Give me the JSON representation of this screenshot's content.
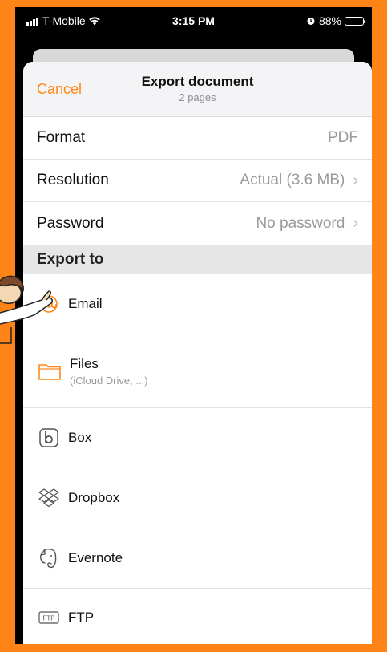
{
  "status": {
    "carrier": "T-Mobile",
    "time": "3:15 PM",
    "battery": "88%",
    "battery_level": 0.88,
    "alarm_icon": "alarm-icon",
    "wifi_icon": "wifi-icon"
  },
  "nav": {
    "cancel": "Cancel",
    "title": "Export document",
    "subtitle": "2 pages"
  },
  "settings": [
    {
      "label": "Format",
      "value": "PDF",
      "chevron": false
    },
    {
      "label": "Resolution",
      "value": "Actual (3.6 MB)",
      "chevron": true
    },
    {
      "label": "Password",
      "value": "No password",
      "chevron": true
    }
  ],
  "export_header": "Export to",
  "export_targets": [
    {
      "label": "Email",
      "sub": "",
      "icon": "email-icon"
    },
    {
      "label": "Files",
      "sub": "(iCloud Drive, ...)",
      "icon": "folder-icon"
    },
    {
      "label": "Box",
      "sub": "",
      "icon": "box-icon"
    },
    {
      "label": "Dropbox",
      "sub": "",
      "icon": "dropbox-icon"
    },
    {
      "label": "Evernote",
      "sub": "",
      "icon": "evernote-icon"
    },
    {
      "label": "FTP",
      "sub": "",
      "icon": "ftp-icon"
    }
  ],
  "colors": {
    "frame": "#FF8417",
    "accent": "#FF8A1A",
    "sheet": "#FFFFFF",
    "section": "#E6E6E6"
  }
}
